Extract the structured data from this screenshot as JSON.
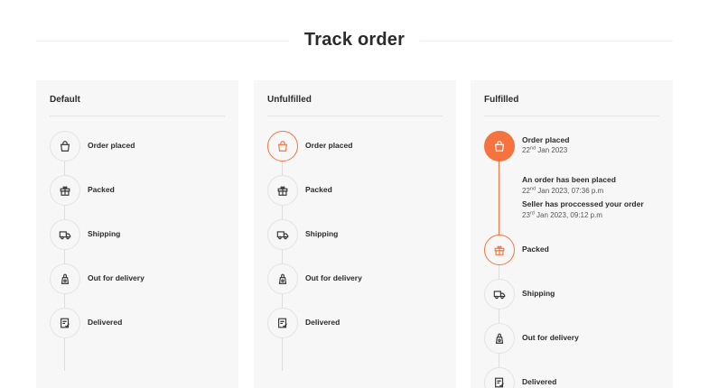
{
  "page": {
    "title": "Track order"
  },
  "colors": {
    "accent": "#f4733f",
    "card_bg": "#f7f7f7",
    "text": "#2b2b2b"
  },
  "cards": [
    {
      "title": "Default",
      "steps": [
        {
          "label": "Order placed",
          "icon": "bag-icon"
        },
        {
          "label": "Packed",
          "icon": "gift-icon"
        },
        {
          "label": "Shipping",
          "icon": "truck-icon"
        },
        {
          "label": "Out for delivery",
          "icon": "delivery-bag-icon"
        },
        {
          "label": "Delivered",
          "icon": "checklist-icon"
        }
      ]
    },
    {
      "title": "Unfulfilled",
      "steps": [
        {
          "label": "Order placed",
          "icon": "bag-icon"
        },
        {
          "label": "Packed",
          "icon": "gift-icon"
        },
        {
          "label": "Shipping",
          "icon": "truck-icon"
        },
        {
          "label": "Out for delivery",
          "icon": "delivery-bag-icon"
        },
        {
          "label": "Delivered",
          "icon": "checklist-icon"
        }
      ]
    },
    {
      "title": "Fulfilled",
      "placed": {
        "label": "Order placed",
        "date_day": "22",
        "date_sup": "nd",
        "date_rest": " Jan 2023"
      },
      "events": [
        {
          "title": "An order has been placed",
          "day": "22",
          "sup": "nd",
          "rest": " Jan 2023, 07:36 p.m"
        },
        {
          "title": "Seller has proccessed your order",
          "day": "23",
          "sup": "rd",
          "rest": " Jan 2023, 09:12 p.m"
        }
      ],
      "steps": [
        {
          "label": "Packed",
          "icon": "gift-icon"
        },
        {
          "label": "Shipping",
          "icon": "truck-icon"
        },
        {
          "label": "Out for delivery",
          "icon": "delivery-bag-icon"
        },
        {
          "label": "Delivered",
          "icon": "checklist-icon"
        }
      ]
    }
  ]
}
